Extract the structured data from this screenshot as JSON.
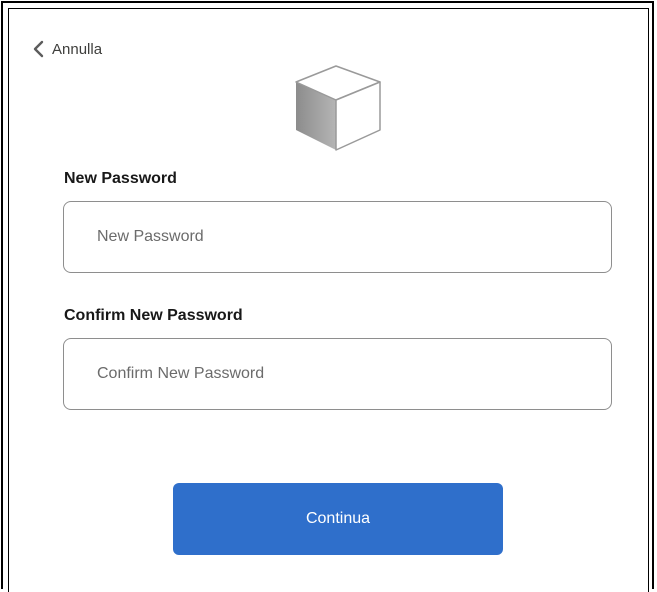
{
  "nav": {
    "back_label": "Annulla"
  },
  "form": {
    "new_password": {
      "label": "New Password",
      "placeholder": "New Password",
      "value": ""
    },
    "confirm_password": {
      "label": "Confirm New Password",
      "placeholder": "Confirm New Password",
      "value": ""
    },
    "submit_label": "Continua"
  },
  "icons": {
    "back": "chevron-left-icon",
    "logo": "cube-logo-icon"
  },
  "colors": {
    "primary_button": "#2f6fcb",
    "input_border": "#8e8e8e",
    "text": "#181818"
  }
}
